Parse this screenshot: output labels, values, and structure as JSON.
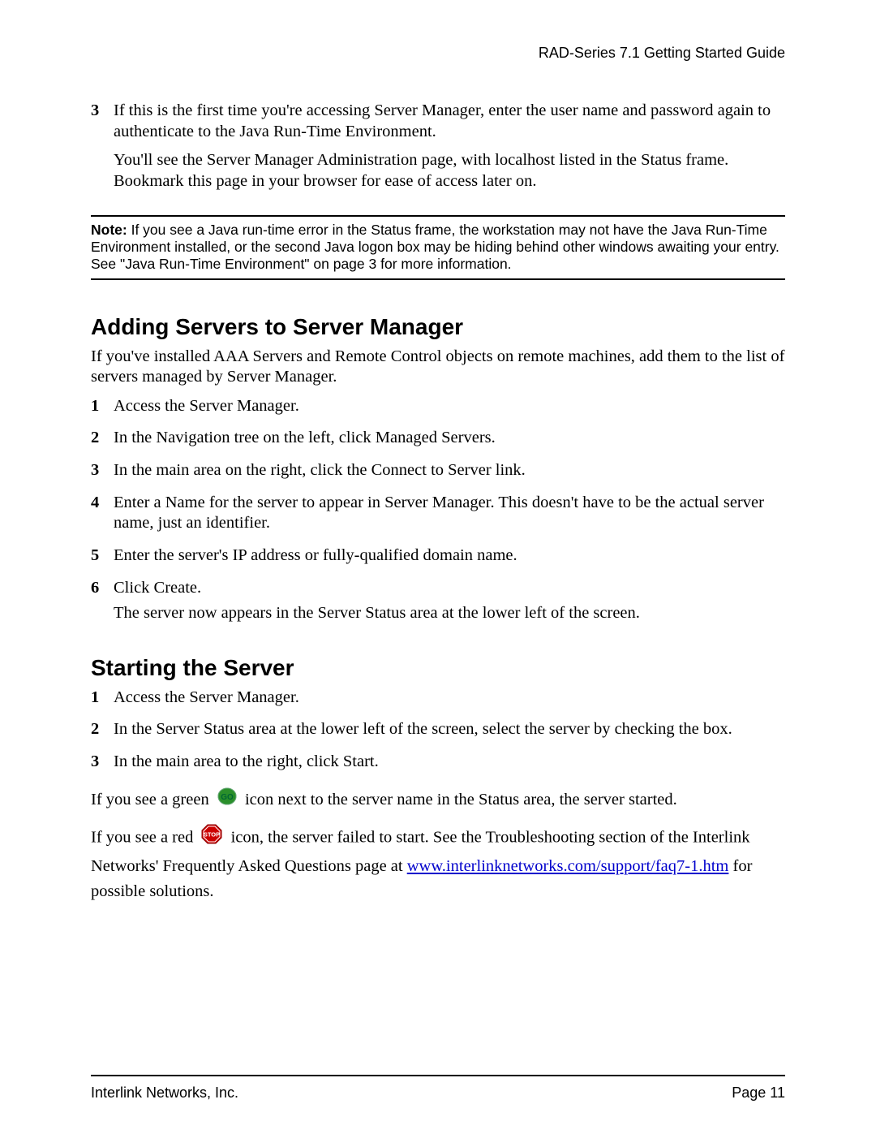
{
  "header": {
    "title": "RAD-Series 7.1 Getting Started Guide"
  },
  "intro_step": {
    "num": "3",
    "p1": "If this is the first time you're accessing Server Manager, enter the user name and password again to authenticate to the Java Run-Time Environment.",
    "p2": "You'll see the Server Manager Administration page, with localhost listed in the Status frame. Bookmark this page in your browser for ease of access later on."
  },
  "note": {
    "label": "Note:",
    "text": " If you see a Java run-time error in the Status frame, the workstation may not have the Java Run-Time Environment installed, or the second Java logon box may be hiding behind other windows awaiting your entry. See \"Java Run-Time Environment\" on page 3 for more information."
  },
  "section1": {
    "heading": "Adding Servers to Server Manager",
    "intro": "If you've installed AAA Servers and Remote Control objects on remote machines, add them to the list of servers managed by Server Manager.",
    "steps": [
      {
        "num": "1",
        "text": "Access the Server Manager."
      },
      {
        "num": "2",
        "text": "In the Navigation tree on the left, click Managed Servers."
      },
      {
        "num": "3",
        "text": "In the main area on the right, click the Connect to Server link."
      },
      {
        "num": "4",
        "text": "Enter a Name for the server to appear in Server Manager. This doesn't have to be the actual server name, just an identifier."
      },
      {
        "num": "5",
        "text": "Enter the server's IP address or fully-qualified domain name."
      },
      {
        "num": "6",
        "text": "Click Create.",
        "extra": "The server now appears in the Server Status area at the lower left of the screen."
      }
    ]
  },
  "section2": {
    "heading": "Starting the Server",
    "steps": [
      {
        "num": "1",
        "text": "Access the Server Manager."
      },
      {
        "num": "2",
        "text": "In the Server Status area at the lower left of the screen, select the server by checking the box."
      },
      {
        "num": "3",
        "text": "In the main area to the right, click Start."
      }
    ],
    "green_before": "If you see a green ",
    "green_after": " icon next to the server name in the Status area, the server started.",
    "red_before": "If you see a red ",
    "red_after_a": " icon, the server failed to start. See the Troubleshooting section of the Interlink Networks' Frequently Asked Questions page at ",
    "faq_link": "www.interlinknetworks.com/support/faq7-1.htm",
    "red_after_b": " for possible solutions."
  },
  "footer": {
    "left": "Interlink Networks, Inc.",
    "right": "Page 11"
  }
}
